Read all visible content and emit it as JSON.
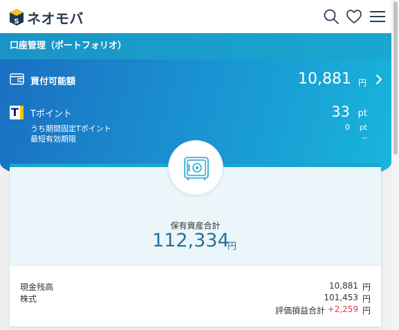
{
  "header": {
    "logo_text": "ネオモバ",
    "icons": [
      "search-icon",
      "heart-icon",
      "menu-icon"
    ]
  },
  "titlebar": {
    "title": "口座管理（ポートフォリオ）"
  },
  "buying_power": {
    "label": "買付可能額",
    "amount": "10,881",
    "unit": "円"
  },
  "tpoint": {
    "logo_letter": "T",
    "label": "Tポイント",
    "value": "33",
    "unit": "pt",
    "limited_label": "うち期間固定Tポイント",
    "limited_value": "0",
    "limited_unit": "pt",
    "expiry_label": "最短有効期限",
    "expiry_value": "--"
  },
  "summary": {
    "total_label": "保有資産合計",
    "total_value": "112,334",
    "total_unit": "円",
    "cash_label": "現金残高",
    "cash_value": "10,881",
    "cash_unit": "円",
    "stocks_label": "株式",
    "stocks_value": "101,453",
    "stocks_unit": "円",
    "eval_label": "評価損益合計",
    "eval_value": "+2,259",
    "eval_unit": "円"
  },
  "colors": {
    "accent": "#19a7cf",
    "navy": "#2b3a52",
    "gain": "#e0393e",
    "total_text": "#2b6f98"
  }
}
